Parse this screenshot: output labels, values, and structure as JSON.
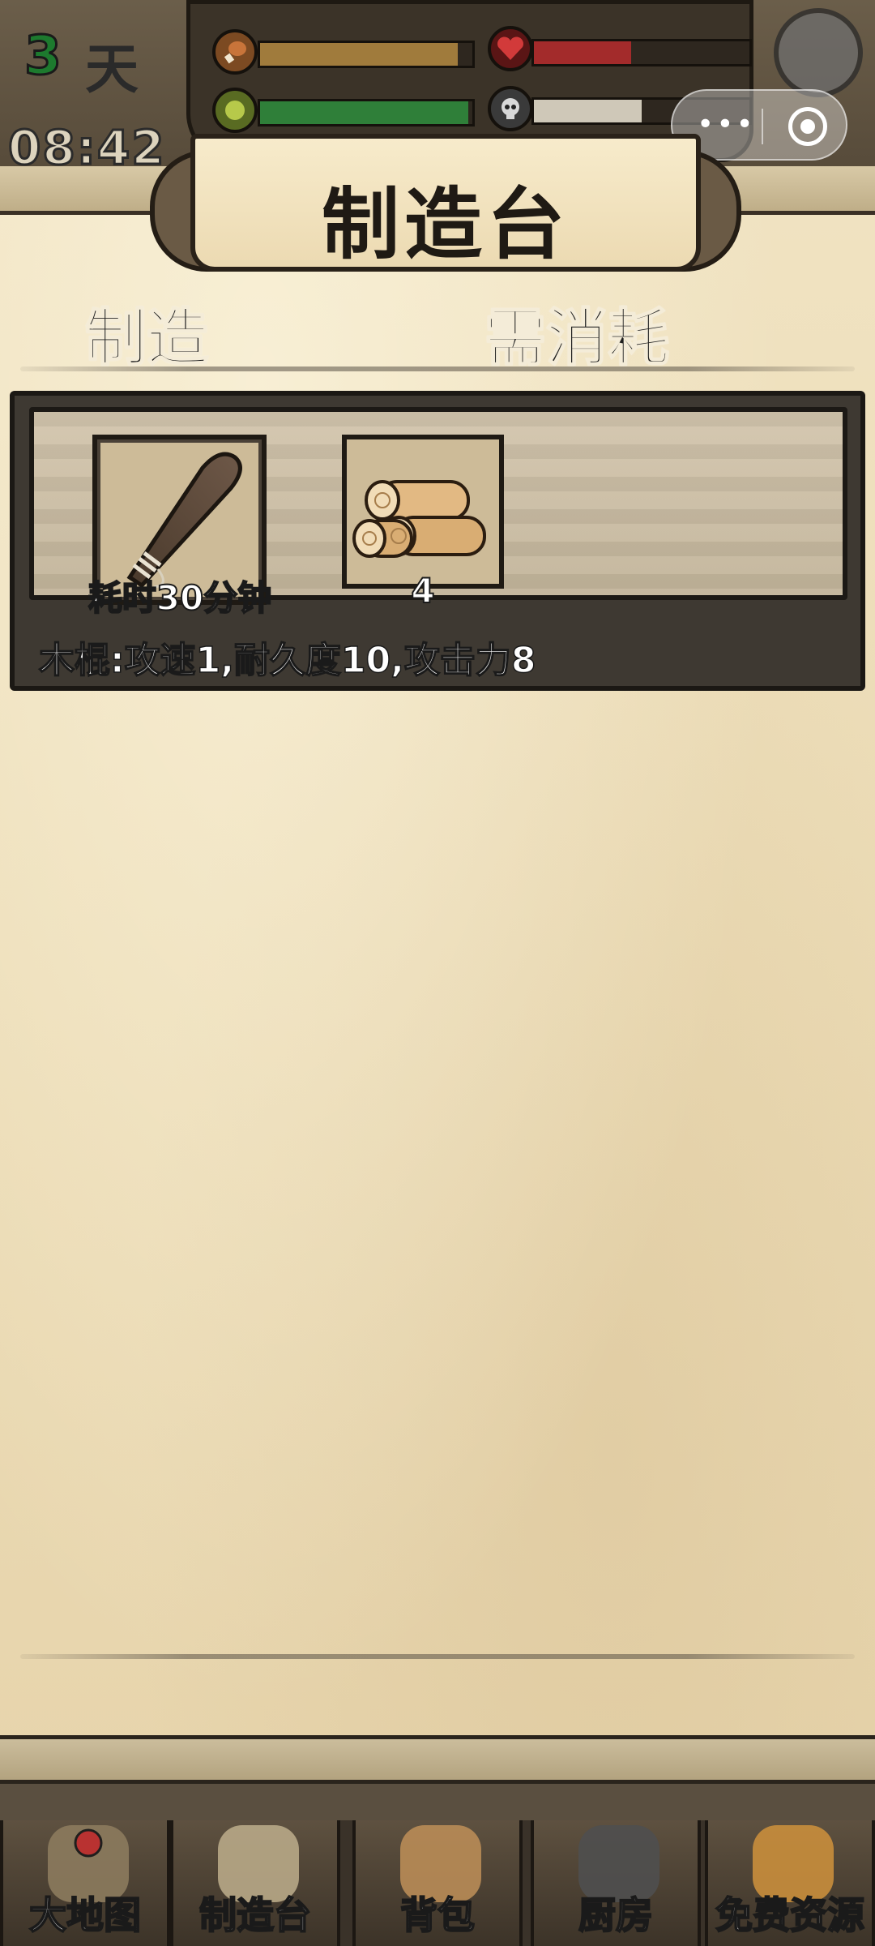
{
  "status": {
    "day_number": "3",
    "day_label": "天",
    "time": "08:42",
    "stats": [
      {
        "name": "hunger",
        "icon": "drumstick-icon",
        "fill": 0.93,
        "color": "#a07b3c"
      },
      {
        "name": "health",
        "icon": "heart-icon",
        "fill": 0.45,
        "color": "#a32b2b"
      },
      {
        "name": "energy",
        "icon": "energy-icon",
        "fill": 0.98,
        "color": "#2f7f39"
      },
      {
        "name": "sanity",
        "icon": "skull-icon",
        "fill": 0.5,
        "color": "#cfc8b8"
      }
    ]
  },
  "screen": {
    "title": "制造台"
  },
  "columns": {
    "craft": "制造",
    "consume": "需消耗"
  },
  "recipes": [
    {
      "item_icon": "wooden-club-icon",
      "time_label": "耗时30分钟",
      "ingredient_icon": "wood-logs-icon",
      "ingredient_count": "4",
      "description": "木棍:攻速1,耐久度10,攻击力8"
    }
  ],
  "nav": {
    "items": [
      {
        "label": "大地图",
        "icon": "map-icon"
      },
      {
        "label": "制造台",
        "icon": "workbench-icon"
      },
      {
        "label": "背包",
        "icon": "backpack-icon"
      },
      {
        "label": "厨房",
        "icon": "cooking-pot-icon"
      },
      {
        "label": "免费资源",
        "icon": "free-resources-icon"
      }
    ]
  },
  "mini_program": {
    "more_glyph": "•••"
  }
}
